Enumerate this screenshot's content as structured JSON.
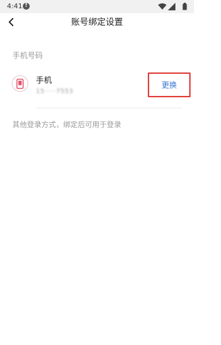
{
  "status_bar": {
    "time": "4:41",
    "icons": [
      "alert-icon",
      "wifi-icon",
      "cell-signal-icon",
      "battery-icon"
    ]
  },
  "header": {
    "title": "账号绑定设置",
    "back_icon": "chevron-left-icon"
  },
  "phone_section": {
    "label": "手机号码",
    "item": {
      "icon": "phone-icon",
      "title": "手机",
      "number_masked": "15·····7553",
      "action_label": "更换"
    }
  },
  "other_login": {
    "hint": "其他登录方式，绑定后可用于登录"
  },
  "colors": {
    "title_text": "#222222",
    "secondary_text": "#9a9a9a",
    "link_blue": "#3573d2",
    "highlight_red": "#e0413c",
    "phone_icon_red": "#e0566a"
  }
}
